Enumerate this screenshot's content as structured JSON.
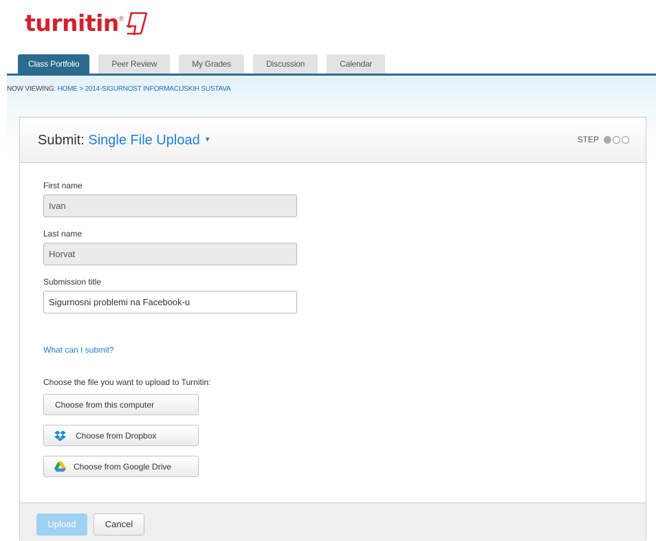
{
  "brand": {
    "logo_text": "turnitin"
  },
  "tabs": [
    {
      "label": "Class Portfolio",
      "active": true
    },
    {
      "label": "Peer Review"
    },
    {
      "label": "My Grades"
    },
    {
      "label": "Discussion"
    },
    {
      "label": "Calendar"
    }
  ],
  "breadcrumb": {
    "prefix": "NOW VIEWING:",
    "home": "HOME",
    "separator": ">",
    "current": "2014-SIGURNOST INFORMACIJSKIH SUSTAVA"
  },
  "panel": {
    "title_prefix": "Submit:",
    "upload_type": "Single File Upload",
    "step_label": "STEP",
    "step_current": 1,
    "step_total": 3
  },
  "form": {
    "first_name_label": "First name",
    "first_name_value": "Ivan",
    "last_name_label": "Last name",
    "last_name_value": "Horvat",
    "title_label": "Submission title",
    "title_value": "Sigurnosni problemi na Facebook-u"
  },
  "help_link": "What can I submit?",
  "choose_text": "Choose the file you want to upload to Turnitin:",
  "buttons": {
    "computer": "Choose from this computer",
    "dropbox": "Choose from Dropbox",
    "gdrive": "Choose from Google Drive",
    "upload": "Upload",
    "cancel": "Cancel"
  },
  "colors": {
    "brand_red": "#d1222e",
    "tab_active": "#2b6b8f",
    "link_blue": "#1e7ed6",
    "upload_disabled": "#9fd1f2"
  }
}
